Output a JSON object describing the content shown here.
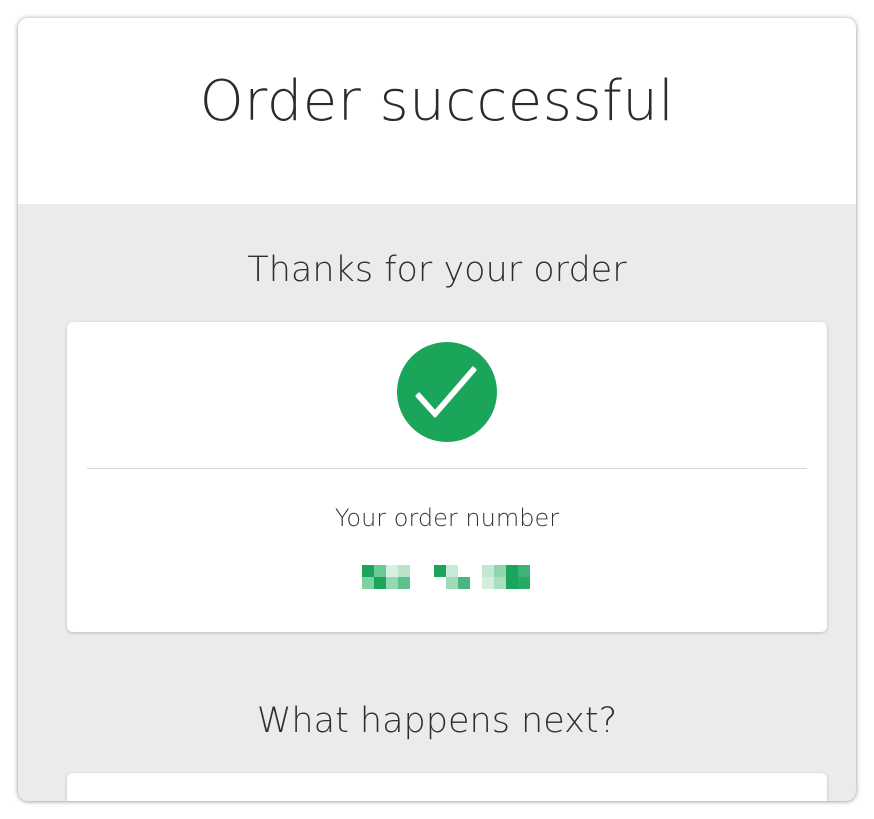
{
  "header": {
    "title": "Order successful"
  },
  "confirmation": {
    "heading": "Thanks for your order",
    "order_number_label": "Your order number",
    "status_icon": "check-icon",
    "accent_color": "#1aa55b"
  },
  "next_steps": {
    "heading": "What happens next?"
  }
}
